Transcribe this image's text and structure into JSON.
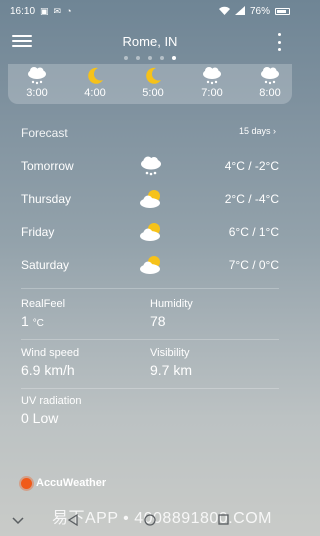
{
  "status_bar": {
    "time": "16:10",
    "battery": "76%"
  },
  "header": {
    "city": "Rome, IN"
  },
  "pager": {
    "count": 5,
    "active_index": 4
  },
  "hourly": [
    {
      "time": "3:00",
      "icon": "cloud-snow-icon"
    },
    {
      "time": "4:00",
      "icon": "moon-icon"
    },
    {
      "time": "5:00",
      "icon": "moon-icon"
    },
    {
      "time": "7:00",
      "icon": "cloud-snow-icon"
    },
    {
      "time": "8:00",
      "icon": "cloud-snow-icon"
    }
  ],
  "forecast": {
    "title": "Forecast",
    "more_label": "15 days",
    "days": [
      {
        "name": "Tomorrow",
        "icon": "cloud-snow-icon",
        "temps": "4°C / -2°C"
      },
      {
        "name": "Thursday",
        "icon": "partly-cloudy-icon",
        "temps": "2°C / -4°C"
      },
      {
        "name": "Friday",
        "icon": "partly-cloudy-icon",
        "temps": "6°C / 1°C"
      },
      {
        "name": "Saturday",
        "icon": "partly-cloudy-icon",
        "temps": "7°C / 0°C"
      }
    ]
  },
  "details": {
    "realfeel": {
      "label": "RealFeel",
      "value": "1",
      "unit": "°C"
    },
    "humidity": {
      "label": "Humidity",
      "value": "78"
    },
    "wind": {
      "label": "Wind speed",
      "value": "6.9 km/h"
    },
    "visibility": {
      "label": "Visibility",
      "value": "9.7 km"
    },
    "uv": {
      "label": "UV radiation",
      "value": "0 Low"
    }
  },
  "brand": {
    "name": "AccuWeather"
  },
  "watermark": {
    "text": "易下APP • 4008891800.COM"
  },
  "colors": {
    "brand_orange": "#f05a1a",
    "sun_yellow": "#f6c21a"
  }
}
